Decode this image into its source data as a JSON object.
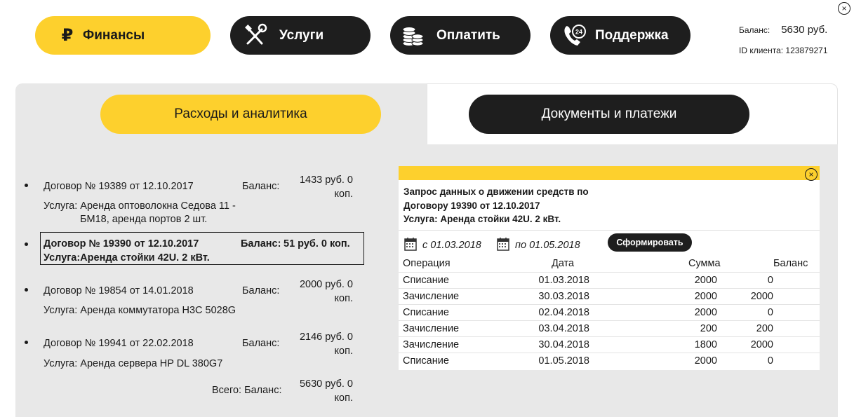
{
  "nav": {
    "finance": "Финансы",
    "services": "Услуги",
    "pay": "Оплатить",
    "support": "Поддержка",
    "finance_icon": "ruble-sign-icon",
    "services_icon": "tools-icon",
    "pay_icon": "coins-icon",
    "support_icon": "phone-24-icon",
    "support_badge": "24",
    "finance_symbol": "₽"
  },
  "account": {
    "balance_label": "Баланс:",
    "balance_value": "5630 руб.",
    "client_id": "ID клиента: 123879271"
  },
  "tabs": {
    "analytics": "Расходы и аналитика",
    "documents": "Документы и платежи"
  },
  "contracts": [
    {
      "title": "Договор № 19389 от 12.10.2017",
      "balance_label": "Баланс:",
      "balance_value_1": "1433 руб. 0",
      "balance_value_2": "коп.",
      "service_1": "Услуга: Аренда оптоволокна Седова 11 -",
      "service_2": "БМ18, аренда портов 2 шт."
    },
    {
      "title": "Договор № 19390 от 12.10.2017",
      "balance_label": "Баланс:",
      "balance_value": "51 руб. 0 коп.",
      "service": "Услуга:Аренда стойки 42U. 2 кВт.",
      "selected": true
    },
    {
      "title": "Договор № 19854 от 14.01.2018",
      "balance_label": "Баланс:",
      "balance_value_1": "2000 руб. 0",
      "balance_value_2": "коп.",
      "service": "Услуга: Аренда коммутатора H3C 5028G"
    },
    {
      "title": "Договор № 19941 от 22.02.2018",
      "balance_label": "Баланс:",
      "balance_value_1": "2146 руб. 0",
      "balance_value_2": "коп.",
      "service": "Услуга: Аренда сервера HP DL 380G7"
    }
  ],
  "total": {
    "label": "Всего: Баланс:",
    "value_1": "5630 руб. 0",
    "value_2": "коп."
  },
  "report": {
    "heading_1": "Запрос данных о движении средств по",
    "heading_2": "Договору 19390 от 12.10.2017",
    "heading_3": "Услуга: Аренда стойки 42U. 2 кВт.",
    "from": "с 01.03.2018",
    "to": "по 01.05.2018",
    "generate": "Сформировать",
    "columns": [
      "Операция",
      "Дата",
      "Сумма",
      "Баланс"
    ],
    "rows": [
      [
        "Списание",
        "01.03.2018",
        "2000",
        "0"
      ],
      [
        "Зачисление",
        "30.03.2018",
        "2000",
        "2000"
      ],
      [
        "Списание",
        "02.04.2018",
        "2000",
        "0"
      ],
      [
        "Зачисление",
        "03.04.2018",
        "200",
        "200"
      ],
      [
        "Зачисление",
        "30.04.2018",
        "1800",
        "2000"
      ],
      [
        "Списание",
        "01.05.2018",
        "2000",
        "0"
      ]
    ]
  },
  "close_glyph": "×",
  "colors": {
    "accent": "#fdd02d",
    "dark": "#1e1e1e",
    "panel": "#e8e8e8"
  }
}
